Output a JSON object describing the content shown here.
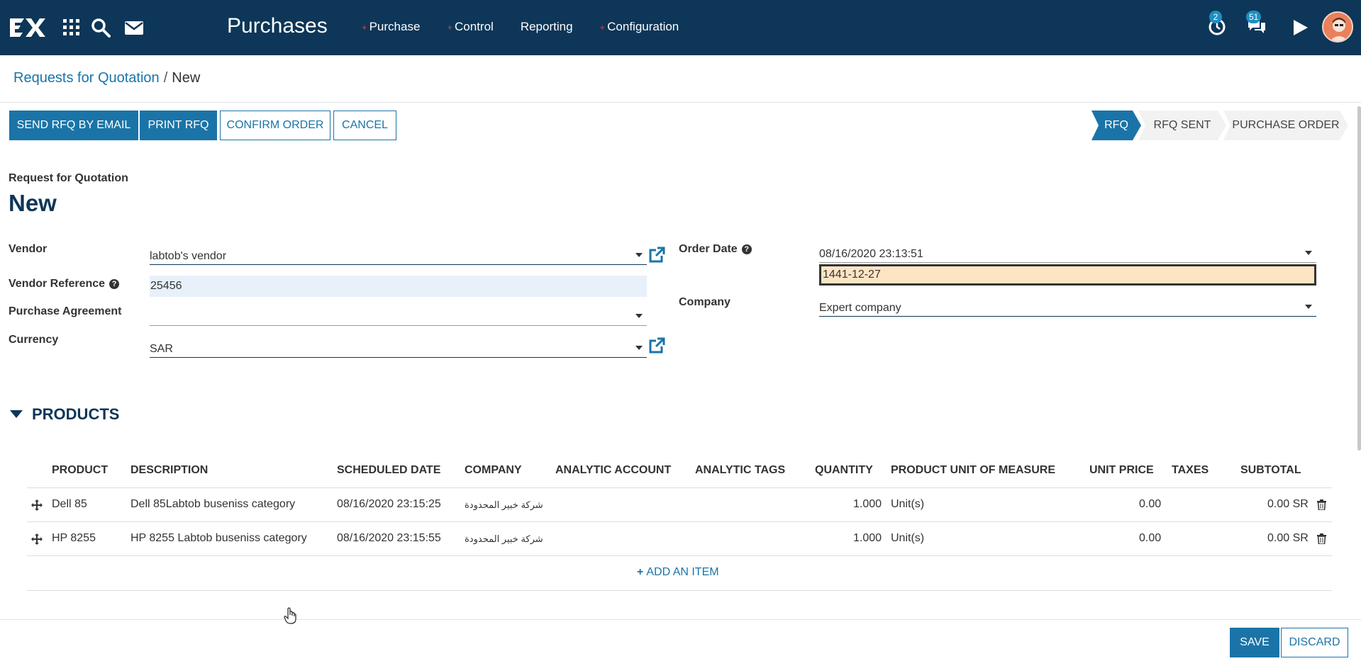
{
  "navbar": {
    "app_title": "Purchases",
    "menu": [
      {
        "label": "Purchase",
        "has_plus": true
      },
      {
        "label": "Control",
        "has_plus": true
      },
      {
        "label": "Reporting",
        "has_plus": false
      },
      {
        "label": "Configuration",
        "has_plus": true
      }
    ],
    "activity_badge": "2",
    "messages_badge": "51",
    "icons": [
      "logo-icon",
      "apps-grid-icon",
      "search-icon",
      "mail-icon",
      "clock-icon",
      "chat-icon",
      "play-icon",
      "user-avatar"
    ],
    "bg_color": "#0d3658"
  },
  "breadcrumb": {
    "parent": "Requests for Quotation",
    "separator": "/",
    "current": "New"
  },
  "actions": {
    "send_rfq": "SEND RFQ BY EMAIL",
    "print_rfq": "PRINT RFQ",
    "confirm_order": "CONFIRM ORDER",
    "cancel": "CANCEL"
  },
  "statusbar": {
    "stages": [
      "RFQ",
      "RFQ SENT",
      "PURCHASE ORDER"
    ],
    "active": "RFQ"
  },
  "form": {
    "subtitle": "Request for Quotation",
    "title": "New",
    "vendor_label": "Vendor",
    "vendor_value": "labtob's vendor",
    "vendor_ref_label": "Vendor Reference",
    "vendor_ref_value": "25456",
    "purchase_agreement_label": "Purchase Agreement",
    "purchase_agreement_value": "",
    "currency_label": "Currency",
    "currency_value": "SAR",
    "order_date_label": "Order Date",
    "order_date_value": "08/16/2020 23:13:51",
    "hijri_date_value": "1441-12-27",
    "company_label": "Company",
    "company_value": "Expert company"
  },
  "products": {
    "section_title": "PRODUCTS",
    "columns": [
      "PRODUCT",
      "DESCRIPTION",
      "SCHEDULED DATE",
      "COMPANY",
      "ANALYTIC ACCOUNT",
      "ANALYTIC TAGS",
      "QUANTITY",
      "PRODUCT UNIT OF MEASURE",
      "UNIT PRICE",
      "TAXES",
      "SUBTOTAL"
    ],
    "rows": [
      {
        "product": "Dell 85",
        "description": "Dell 85Labtob buseniss category",
        "scheduled_date": "08/16/2020 23:15:25",
        "company": "شركة خبير المحدودة",
        "analytic_account": "",
        "analytic_tags": "",
        "quantity": "1.000",
        "uom": "Unit(s)",
        "unit_price": "0.00",
        "taxes": "",
        "subtotal": "0.00 SR"
      },
      {
        "product": "HP 8255",
        "description": "HP 8255 Labtob buseniss category",
        "scheduled_date": "08/16/2020 23:15:55",
        "company": "شركة خبير المحدودة",
        "analytic_account": "",
        "analytic_tags": "",
        "quantity": "1.000",
        "uom": "Unit(s)",
        "unit_price": "0.00",
        "taxes": "",
        "subtotal": "0.00 SR"
      }
    ],
    "add_item": "ADD AN ITEM"
  },
  "footer": {
    "save": "SAVE",
    "discard": "DISCARD"
  },
  "colors": {
    "primary": "#1a74a8",
    "navy": "#0d3658",
    "highlight_field": "#fde5c4",
    "filled_field": "#e8f0fa"
  }
}
